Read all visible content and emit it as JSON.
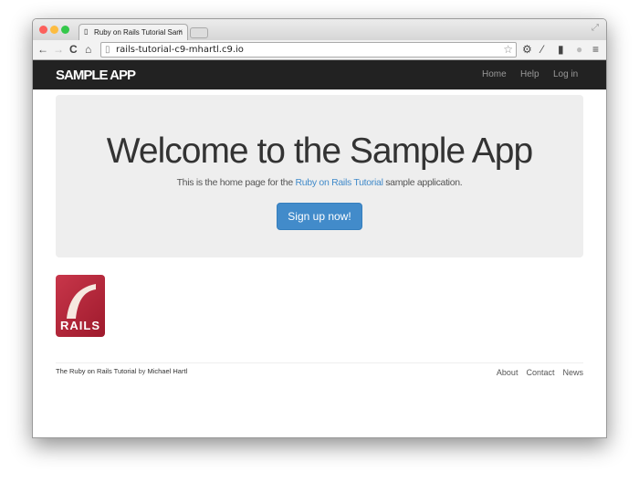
{
  "browser": {
    "tab_title": "Ruby on Rails Tutorial Sam",
    "url": "rails-tutorial-c9-mhartl.c9.io"
  },
  "navbar": {
    "brand": "SAMPLE APP",
    "links": [
      "Home",
      "Help",
      "Log in"
    ]
  },
  "hero": {
    "title": "Welcome to the Sample App",
    "text_before": "This is the home page for the ",
    "link": "Ruby on Rails Tutorial",
    "text_after": " sample application.",
    "button": "Sign up now!"
  },
  "logo": {
    "text": "RAILS"
  },
  "footer": {
    "link1": "The Ruby on Rails Tutorial",
    "by": " by ",
    "link2": "Michael Hartl",
    "links": [
      "About",
      "Contact",
      "News"
    ]
  },
  "colors": {
    "accent": "#428bca",
    "navbar": "#222222"
  }
}
